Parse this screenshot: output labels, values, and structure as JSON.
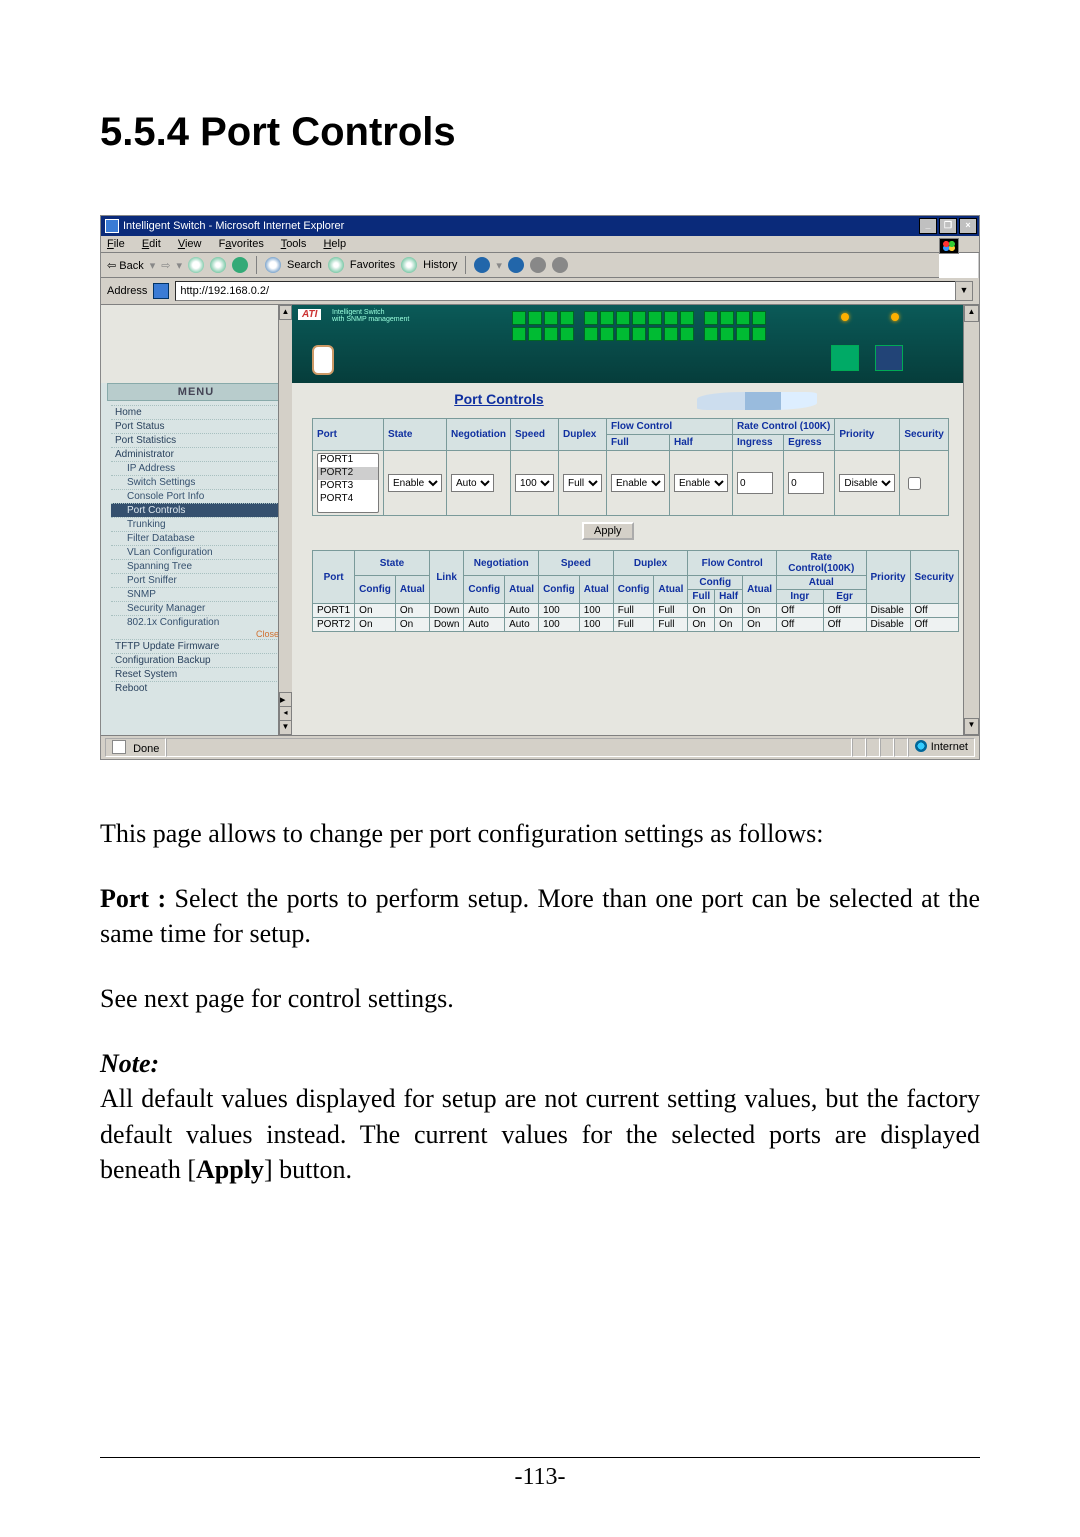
{
  "heading": "5.5.4 Port Controls",
  "browser": {
    "title": "Intelligent Switch - Microsoft Internet Explorer",
    "window_buttons": {
      "min": "_",
      "max": "❐",
      "close": "×"
    },
    "menus": [
      "File",
      "Edit",
      "View",
      "Favorites",
      "Tools",
      "Help"
    ],
    "toolbar": {
      "back": "Back",
      "search": "Search",
      "favorites": "Favorites",
      "history": "History"
    },
    "address_label": "Address",
    "address_value": "http://192.168.0.2/",
    "status_done": "Done",
    "status_zone": "Internet"
  },
  "menu": {
    "header": "MENU",
    "items": [
      "Home",
      "Port Status",
      "Port Statistics",
      "Administrator"
    ],
    "admin_sub": [
      "IP Address",
      "Switch Settings",
      "Console Port Info",
      "Port Controls",
      "Trunking",
      "Filter Database",
      "VLan Configuration",
      "Spanning Tree",
      "Port Sniffer",
      "SNMP",
      "Security Manager",
      "802.1x Configuration"
    ],
    "close": "Close",
    "tail": [
      "TFTP Update Firmware",
      "Configuration Backup",
      "Reset System",
      "Reboot"
    ]
  },
  "port_controls": {
    "title": "Port Controls",
    "header": {
      "port": "Port",
      "state": "State",
      "negotiation": "Negotiation",
      "speed": "Speed",
      "duplex": "Duplex",
      "flow": "Flow Control",
      "flow_full": "Full",
      "flow_half": "Half",
      "rate": "Rate Control (100K)",
      "rate_in": "Ingress",
      "rate_eg": "Egress",
      "priority": "Priority",
      "security": "Security"
    },
    "port_options": [
      "PORT1",
      "PORT2",
      "PORT3",
      "PORT4"
    ],
    "selected_port": "PORT2",
    "values": {
      "state": "Enable",
      "negotiation": "Auto",
      "speed": "100",
      "duplex": "Full",
      "flow_full": "Enable",
      "flow_half": "Enable",
      "ingress": "0",
      "egress": "0",
      "priority": "Disable",
      "security_checked": false
    },
    "apply": "Apply"
  },
  "status_table": {
    "header": {
      "port": "Port",
      "state": "State",
      "state_config": "Config",
      "state_atual": "Atual",
      "link": "Link",
      "negotiation": "Negotiation",
      "neg_config": "Config",
      "neg_atual": "Atual",
      "speed": "Speed",
      "spd_config": "Config",
      "spd_atual": "Atual",
      "duplex": "Duplex",
      "dup_config": "Config",
      "dup_atual": "Atual",
      "flow": "Flow Control",
      "flow_cfg": "Config",
      "flow_cfg_full": "Full",
      "flow_cfg_half": "Half",
      "flow_atual": "Atual",
      "rate": "Rate Control(100K)",
      "rate_atual": "Atual",
      "rate_ingr": "Ingr",
      "rate_egr": "Egr",
      "priority": "Priority",
      "security": "Security"
    },
    "rows": [
      {
        "port": "PORT1",
        "stc": "On",
        "sta": "On",
        "link": "Down",
        "negc": "Auto",
        "nega": "Auto",
        "spc": "100",
        "spa": "100",
        "dpc": "Full",
        "dpa": "Full",
        "ff": "On",
        "fh": "On",
        "fat": "On",
        "ri": "Off",
        "re": "Off",
        "pri": "Disable",
        "sec": "Off"
      },
      {
        "port": "PORT2",
        "stc": "On",
        "sta": "On",
        "link": "Down",
        "negc": "Auto",
        "nega": "Auto",
        "spc": "100",
        "spa": "100",
        "dpc": "Full",
        "dpa": "Full",
        "ff": "On",
        "fh": "On",
        "fat": "On",
        "ri": "Off",
        "re": "Off",
        "pri": "Disable",
        "sec": "Off"
      }
    ]
  },
  "body": {
    "p1": "This page allows to change per port configuration settings as follows:",
    "p2a": "Port :",
    "p2b": " Select the ports to perform setup. More than one port can be selected at the same time for setup.",
    "p3": "See next page for control settings.",
    "note_label": "Note:",
    "note": "All default values displayed for setup are not current setting values, but the factory default values instead. The current values for the selected ports are displayed beneath [",
    "note_apply": "Apply",
    "note_tail": "] button."
  },
  "page_number": "-113-"
}
